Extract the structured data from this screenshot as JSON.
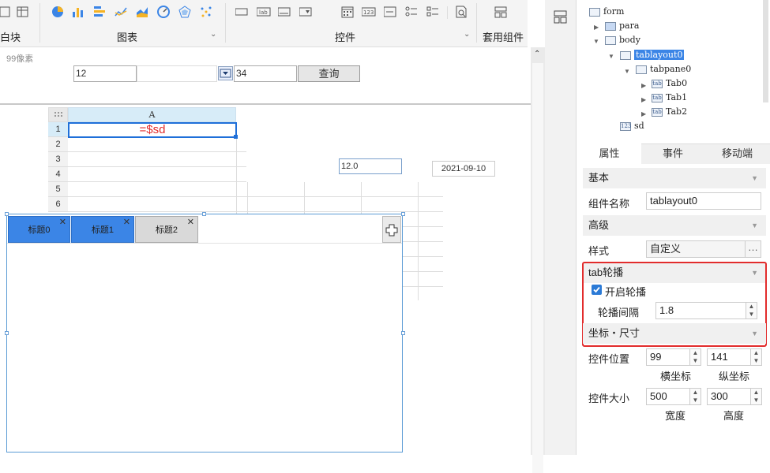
{
  "toolbar": {
    "group_block": "白块",
    "group_chart": "图表",
    "group_control": "控件",
    "group_template": "套用组件",
    "chart_icons": [
      "pie-chart-icon",
      "bar-chart-icon",
      "horizontal-bar-icon",
      "line-chart-icon",
      "area-chart-icon",
      "gauge-icon",
      "radar-icon",
      "scatter-icon"
    ],
    "control_icons": [
      "label-icon",
      "text-field-icon",
      "textarea-icon",
      "combo-icon",
      "date-icon",
      "number-icon",
      "radio-icon",
      "checkbox-icon",
      "preview-icon"
    ]
  },
  "canvas": {
    "para_note": "99像素",
    "param_value1": "12",
    "param_value3": "34",
    "query_label": "查询",
    "col_header": "A",
    "row_numbers": [
      "1",
      "2",
      "3",
      "4",
      "5",
      "6"
    ],
    "formula": "=$sd",
    "number_value": "12.0",
    "date_value": "2021-09-10",
    "tabs": [
      {
        "label": "标题0",
        "active": true
      },
      {
        "label": "标题1",
        "active": true
      },
      {
        "label": "标题2",
        "active": false
      }
    ]
  },
  "tree": {
    "form": "form",
    "para": "para",
    "body": "body",
    "tablayout": "tablayout0",
    "tabpane": "tabpane0",
    "tab0": "Tab0",
    "tab1": "Tab1",
    "tab2": "Tab2",
    "sd": "sd"
  },
  "panel_tabs": {
    "props": "属性",
    "events": "事件",
    "mobile": "移动端"
  },
  "props": {
    "basic": "基本",
    "name_label": "组件名称",
    "name_value": "tablayout0",
    "advanced": "高级",
    "style_label": "样式",
    "style_value": "自定义",
    "carousel_section": "tab轮播",
    "carousel_enable": "开启轮播",
    "carousel_interval_label": "轮播间隔",
    "carousel_interval": "1.8",
    "coords_section": "坐标・尺寸",
    "position_label": "控件位置",
    "pos_x": "99",
    "pos_y": "141",
    "x_label": "横坐标",
    "y_label": "纵坐标",
    "size_label": "控件大小",
    "width": "500",
    "height": "300",
    "w_label": "宽度",
    "h_label": "高度"
  },
  "colors": {
    "accent": "#3b85e6",
    "highlight": "#e22c2c",
    "selection": "#1e6fd9"
  }
}
